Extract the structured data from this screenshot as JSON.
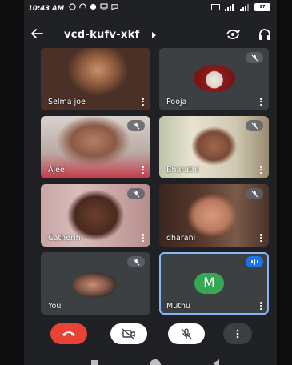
{
  "status_bar": {
    "time": "10:43 AM",
    "battery": "97"
  },
  "header": {
    "meeting_code": "vcd-kufv-xkf"
  },
  "participants": [
    {
      "name": "Selma joe",
      "muted": true
    },
    {
      "name": "Pooja",
      "muted": true
    },
    {
      "name": "Ajee",
      "muted": true
    },
    {
      "name": "Bharathi",
      "muted": true
    },
    {
      "name": "Catherin",
      "muted": true
    },
    {
      "name": "dharani",
      "muted": true
    },
    {
      "name": "You",
      "muted": true
    },
    {
      "name": "Muthu",
      "muted": false,
      "speaking": true,
      "avatar_letter": "M"
    }
  ],
  "colors": {
    "end_call": "#ea4335",
    "speaking_badge": "#1a73e8",
    "active_border": "#8ab4f8",
    "avatar_green": "#34a853",
    "background": "#202124",
    "tile": "#3c4043"
  },
  "icons": {
    "back": "arrow-left-icon",
    "switch_camera": "camera-switch-icon",
    "audio_output": "headphones-icon",
    "end_call": "phone-hangup-icon",
    "camera": "camera-off-icon",
    "microphone": "mic-off-icon",
    "more": "more-vertical-icon"
  }
}
